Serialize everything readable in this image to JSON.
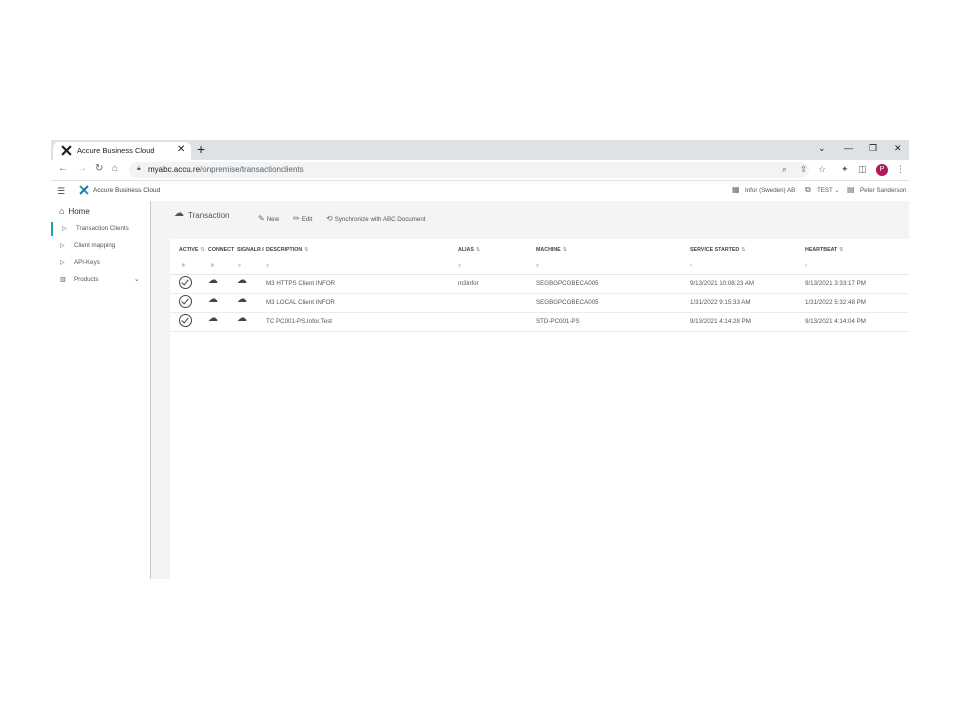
{
  "browser": {
    "tab_title": "Accure Business Cloud",
    "url_host": "myabc.accu.re",
    "url_path": "/onpremise/transactionclients",
    "profile_initial": "P"
  },
  "header": {
    "app_title": "Accure Business Cloud",
    "company": "Infor (Sweden) AB",
    "environment": "TEST",
    "user": "Peter Sanderson"
  },
  "sidebar": {
    "home": "Home",
    "items": [
      {
        "label": "Transaction Clients"
      },
      {
        "label": "Client mapping"
      },
      {
        "label": "API-Keys"
      },
      {
        "label": "Products"
      }
    ]
  },
  "page": {
    "title": "Transaction",
    "actions": {
      "new": "New",
      "edit": "Edit",
      "sync": "Synchronize with ABC Document"
    }
  },
  "table": {
    "columns": {
      "active": "ACTIVE",
      "connect": "CONNECT",
      "signal": "SIGNALR I",
      "description": "DESCRIPTION",
      "alias": "ALIAS",
      "machine": "MACHINE",
      "service_started": "SERVICE STARTED",
      "heartbeat": "HEARTBEAT"
    },
    "rows": [
      {
        "description": "M3 HTTPS Client INFOR",
        "alias": "m3infor",
        "machine": "SEGBGPCGBECA005",
        "service_started": "9/13/2021 10:08:23 AM",
        "heartbeat": "9/13/2021 3:33:17 PM"
      },
      {
        "description": "M3 LOCAL Client INFOR",
        "alias": "",
        "machine": "SEGBGPCGBECA005",
        "service_started": "1/31/2022 9:15:33 AM",
        "heartbeat": "1/31/2022 5:32:48 PM"
      },
      {
        "description": "TC PC001-PS.Infor.Test",
        "alias": "",
        "machine": "STD-PC001-PS",
        "service_started": "9/13/2021 4:14:28 PM",
        "heartbeat": "9/13/2021 4:14:04 PM"
      }
    ]
  },
  "colors": {
    "accent": "#1aa6a6",
    "profile": "#b3165b"
  }
}
